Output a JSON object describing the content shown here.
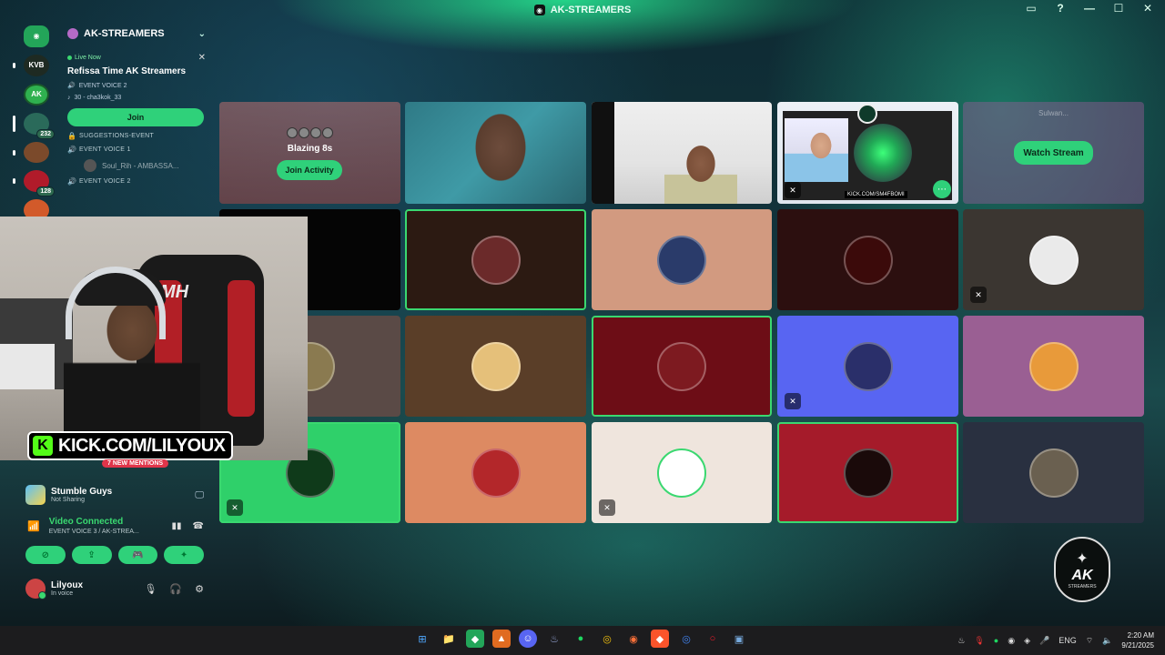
{
  "window": {
    "title": "AK-STREAMERS",
    "controls": [
      "▭",
      "?",
      "—",
      "☐",
      "✕"
    ]
  },
  "rail": {
    "servers": [
      {
        "label": "",
        "color": "#23a559",
        "badge": ""
      },
      {
        "label": "KVB",
        "color": "#1e2a22",
        "badge": ""
      },
      {
        "label": "AK",
        "color": "#2fb14f",
        "badge": ""
      },
      {
        "label": "",
        "color": "#2a6a5a",
        "badge": "232"
      },
      {
        "label": "",
        "color": "#7b4a2b",
        "badge": ""
      },
      {
        "label": "",
        "color": "#b11b2a",
        "badge": "128"
      },
      {
        "label": "",
        "color": "#d25a2a",
        "badge": ""
      }
    ]
  },
  "channels": {
    "server_name": "AK-STREAMERS",
    "live_label": "Live Now",
    "event_title": "Refissa Time AK Streamers",
    "event_channel": "EVENT VOICE 2",
    "event_host": "30 - cha3kok_33",
    "join_label": "Join",
    "list": [
      {
        "name": "SUGGESTIONS-EVENT",
        "icon": "🔒"
      },
      {
        "name": "EVENT VOICE 1",
        "icon": "🔊"
      }
    ],
    "member": "Soul_Rih - AMBASSA...",
    "list2": [
      {
        "name": "EVENT VOICE 2",
        "icon": "🔊"
      }
    ]
  },
  "overlay": {
    "kick_text": "KICK.COM/LILYOUX",
    "kick_letter": "K",
    "chair_brand": "MH"
  },
  "mentions": "7 NEW MENTIONS",
  "activity": {
    "name": "Stumble Guys",
    "status": "Not Sharing"
  },
  "voice": {
    "status": "Video Connected",
    "channel": "EVENT VOICE 3 / AK-STREA..."
  },
  "user": {
    "name": "Lilyoux",
    "status": "In voice"
  },
  "stage": {
    "activity_tile": {
      "name": "Blazing 8s",
      "button": "Join Activity"
    },
    "stream_tile": {
      "title": "Sulwan...",
      "button": "Watch Stream"
    },
    "stream3_url": "KICK.COM/SM4FBOMI",
    "tiles_colors": [
      "#2c1a12",
      "#d29a80",
      "#2c0f0f",
      "#3b3631",
      "#5a4a46",
      "#5a3e28",
      "#6d0d16",
      "#5865f2",
      "#9a5f93",
      "#2fd06a",
      "#dd8a62",
      "#efe5dd",
      "#a51b2a",
      "#293040"
    ]
  },
  "watermark": {
    "line1": "AK",
    "line2": "STREAMERS"
  },
  "taskbar": {
    "apps": [
      "⊞",
      "📁",
      "◆",
      "▲",
      "☺",
      "♨",
      "●",
      "◎",
      "◉",
      "◆",
      "◎",
      "○",
      "▣"
    ],
    "lang": "ENG",
    "time": "2:20 AM",
    "date": "9/21/2025"
  }
}
